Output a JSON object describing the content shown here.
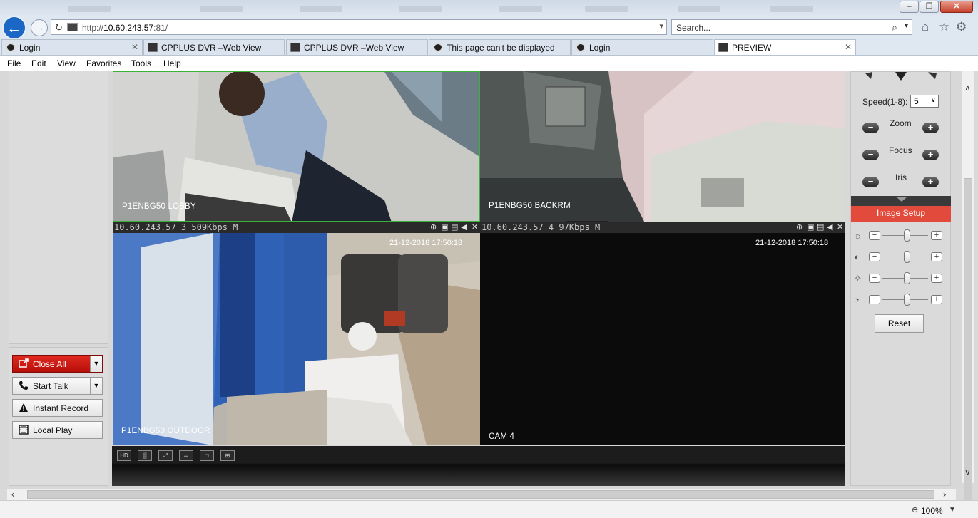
{
  "browser": {
    "address": {
      "prefix": "http://",
      "host": "10.60.243.57",
      "suffix": ":81/"
    },
    "search_placeholder": "Search...",
    "tabs": [
      {
        "label": "Login",
        "active": false
      },
      {
        "label": "CPPLUS DVR –Web View",
        "active": false
      },
      {
        "label": "CPPLUS DVR –Web View",
        "active": false
      },
      {
        "label": "This page can't be displayed",
        "active": false
      },
      {
        "label": "Login",
        "active": false
      },
      {
        "label": "PREVIEW",
        "active": true
      }
    ],
    "menu": [
      "File",
      "Edit",
      "View",
      "Favorites",
      "Tools",
      "Help"
    ],
    "zoom": "100%"
  },
  "left_buttons": {
    "close_all": "Close All",
    "start_talk": "Start Talk",
    "instant_record": "Instant Record",
    "local_play": "Local Play"
  },
  "cameras": [
    {
      "label": "P1ENBG50 LOBBY",
      "info": "",
      "timestamp": ""
    },
    {
      "label": "P1ENBG50 BACKRM",
      "info": "",
      "timestamp": ""
    },
    {
      "label": "P1ENBG50 OUTDOOR",
      "info": "10.60.243.57_3_509Kbps_M",
      "timestamp": "21-12-2018 17:50:18"
    },
    {
      "label": "CAM 4",
      "info": "10.60.243.57_4_97Kbps_M",
      "timestamp": "21-12-2018 17:50:18"
    }
  ],
  "ptz": {
    "speed_label": "Speed(1-8):",
    "speed_value": "5",
    "zoom_label": "Zoom",
    "focus_label": "Focus",
    "iris_label": "Iris",
    "minus": "−",
    "plus": "+"
  },
  "image_setup": {
    "title": "Image Setup",
    "reset": "Reset",
    "sliders": [
      {
        "name": "brightness",
        "level": 0.55
      },
      {
        "name": "contrast",
        "level": 0.55
      },
      {
        "name": "saturation",
        "level": 0.55
      },
      {
        "name": "hue",
        "level": 0.55
      }
    ]
  }
}
